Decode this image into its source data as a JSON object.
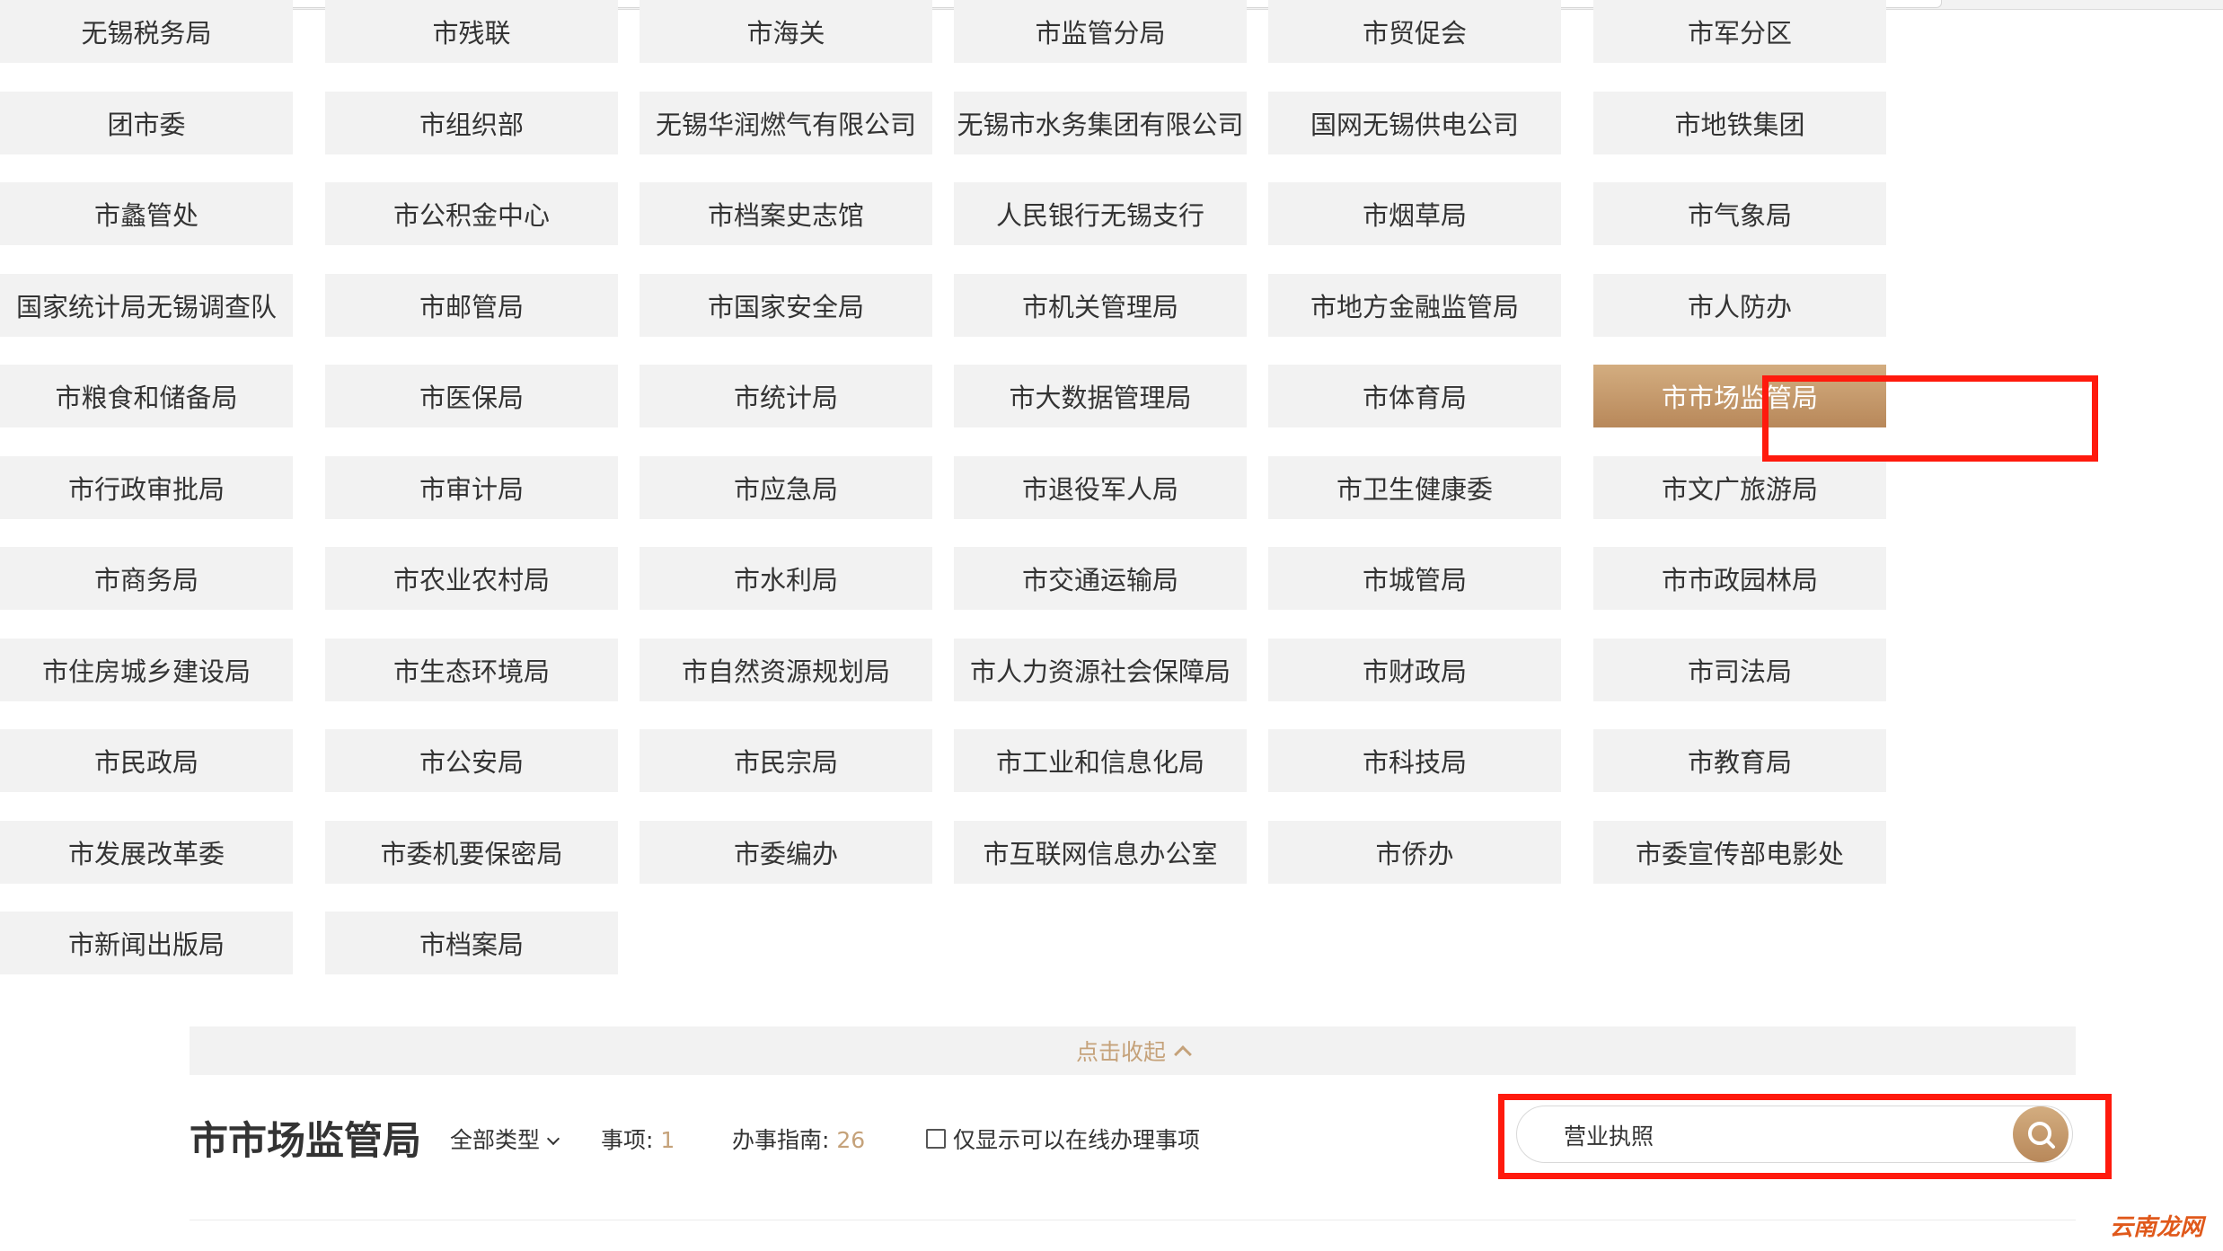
{
  "departments": [
    "无锡税务局",
    "市残联",
    "市海关",
    "市监管分局",
    "市贸促会",
    "市军分区",
    "团市委",
    "市组织部",
    "无锡华润燃气有限公司",
    "无锡市水务集团有限公司",
    "国网无锡供电公司",
    "市地铁集团",
    "市蠡管处",
    "市公积金中心",
    "市档案史志馆",
    "人民银行无锡支行",
    "市烟草局",
    "市气象局",
    "国家统计局无锡调查队",
    "市邮管局",
    "市国家安全局",
    "市机关管理局",
    "市地方金融监管局",
    "市人防办",
    "市粮食和储备局",
    "市医保局",
    "市统计局",
    "市大数据管理局",
    "市体育局",
    "市市场监管局",
    "市行政审批局",
    "市审计局",
    "市应急局",
    "市退役军人局",
    "市卫生健康委",
    "市文广旅游局",
    "市商务局",
    "市农业农村局",
    "市水利局",
    "市交通运输局",
    "市城管局",
    "市市政园林局",
    "市住房城乡建设局",
    "市生态环境局",
    "市自然资源规划局",
    "市人力资源社会保障局",
    "市财政局",
    "市司法局",
    "市民政局",
    "市公安局",
    "市民宗局",
    "市工业和信息化局",
    "市科技局",
    "市教育局",
    "市发展改革委",
    "市委机要保密局",
    "市委编办",
    "市互联网信息办公室",
    "市侨办",
    "市委宣传部电影处",
    "市新闻出版局",
    "市档案局"
  ],
  "active_department": "市市场监管局",
  "collapse_label": "点击收起",
  "toolbar": {
    "title": "市市场监管局",
    "type_filter": "全部类型",
    "items_label": "事项: ",
    "items_count": "1",
    "guide_label": "办事指南: ",
    "guide_count": "26",
    "online_only_label": "仅显示可以在线办理事项"
  },
  "search": {
    "value": "营业执照"
  },
  "watermark": "云南龙网",
  "colors": {
    "accent": "#c5a27a",
    "highlight": "#ff1a0d",
    "tile": "#f2f2f2"
  }
}
